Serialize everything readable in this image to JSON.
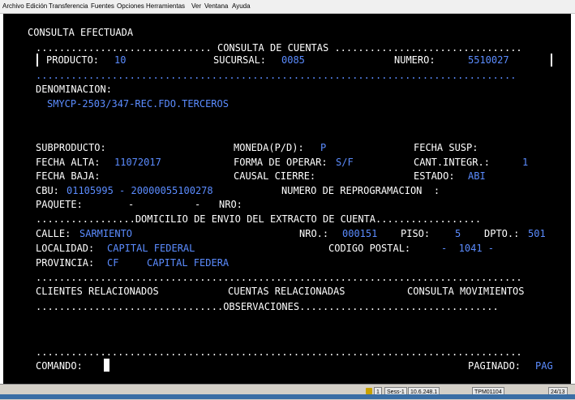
{
  "menu": {
    "items": [
      "Archivo",
      "Edición",
      "Transferencia",
      "Fuentes",
      "Opciones",
      "Herramientas",
      "Ver",
      "Ventana",
      "Ayuda"
    ]
  },
  "screen": {
    "title": "CONSULTA EFECTUADA",
    "header_line": ".............................. CONSULTA DE CUENTAS ................................",
    "producto_label": "PRODUCTO:",
    "producto_value": "10",
    "sucursal_label": "SUCURSAL:",
    "sucursal_value": "0085",
    "numero_label": "NUMERO:",
    "numero_value": "5510027",
    "dotted_line_blue": "..................................................................................",
    "denominacion_label": "DENOMINACION:",
    "denominacion_value": "SMYCP-2503/347-REC.FDO.TERCEROS",
    "subproducto_label": "SUBPRODUCTO:",
    "moneda_label": "MONEDA(P/D):",
    "moneda_value": "P",
    "fecha_susp_label": "FECHA SUSP:",
    "fecha_alta_label": "FECHA ALTA:",
    "fecha_alta_value": "11072017",
    "forma_operar_label": "FORMA DE OPERAR:",
    "forma_operar_value": "S/F",
    "cant_integr_label": "CANT.INTEGR.:",
    "cant_integr_value": "1",
    "fecha_baja_label": "FECHA BAJA:",
    "causal_cierre_label": "CAUSAL CIERRE:",
    "estado_label": "ESTADO:",
    "estado_value": "ABI",
    "cbu_label": "CBU:",
    "cbu_value": "01105995 - 20000055100278",
    "reprog_label": "NUMERO DE REPROGRAMACION  :",
    "paquete_label": "PAQUETE:",
    "paquete_dash1": "-",
    "paquete_dash2": "-",
    "nro_label": "NRO:",
    "domicilio_line": ".................DOMICILIO DE ENVIO DEL EXTRACTO DE CUENTA..................",
    "calle_label": "CALLE:",
    "calle_value": "SARMIENTO",
    "nro2_label": "NRO.:",
    "nro2_value": "000151",
    "piso_label": "PISO:",
    "piso_value": "5",
    "dpto_label": "DPTO.:",
    "dpto_value": "501",
    "localidad_label": "LOCALIDAD:",
    "localidad_value": "CAPITAL FEDERAL",
    "codigo_postal_label": "CODIGO POSTAL:",
    "codigo_postal_value": "-  1041 -",
    "provincia_label": "PROVINCIA:",
    "provincia_code": "CF",
    "provincia_value": "CAPITAL FEDERA",
    "dotted_line_white": "...................................................................................",
    "clientes_rel": "CLIENTES RELACIONADOS",
    "cuentas_rel": "CUENTAS RELACIONADAS",
    "consulta_mov": "CONSULTA MOVIMIENTOS",
    "observaciones_line": "................................OBSERVACIONES..................................",
    "dotted_line_bottom": "...................................................................................",
    "comando_label": "COMANDO:",
    "paginado_label": "PAGINADO:",
    "paginado_value": "PAG"
  },
  "status": {
    "cell1": "1",
    "cell2": "Sess-1",
    "cell3": "10.6.248.1",
    "cell4": "TPM01104",
    "cell5": "24/13"
  }
}
